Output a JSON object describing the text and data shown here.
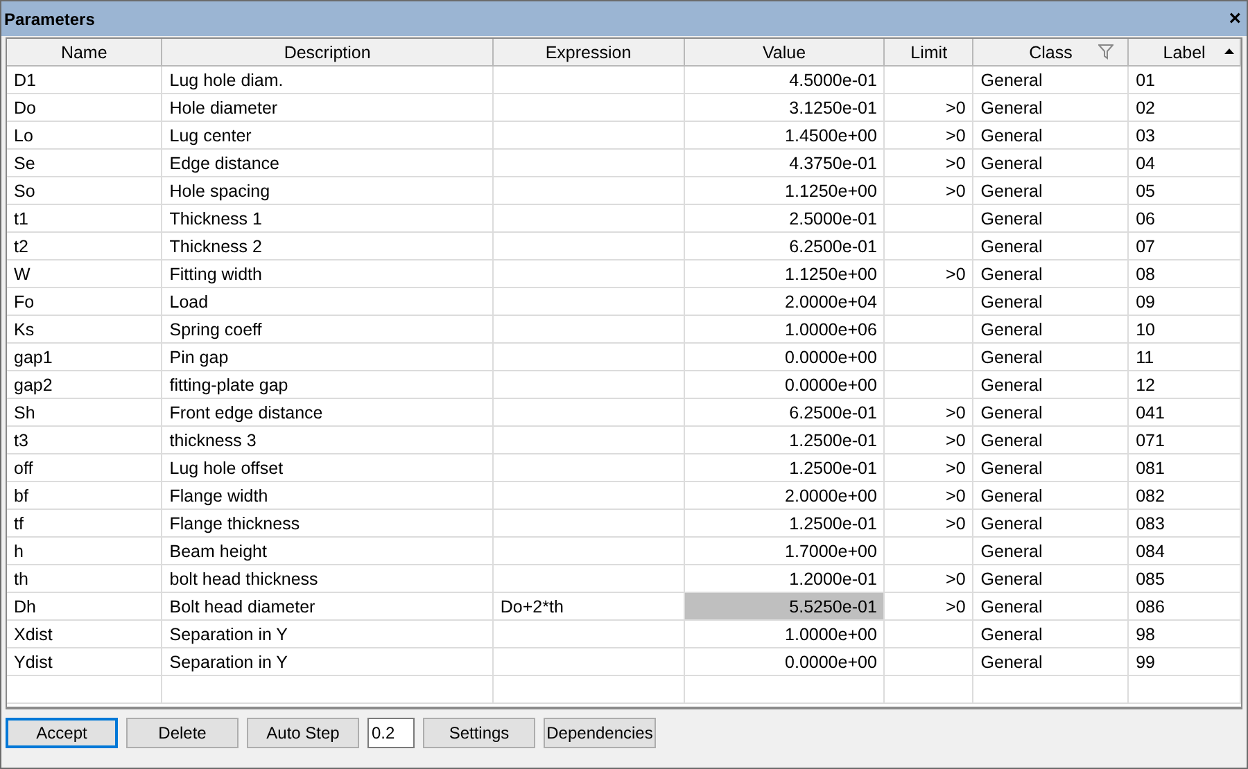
{
  "window": {
    "title": "Parameters",
    "close": "×"
  },
  "table": {
    "columns": [
      {
        "label": "Name",
        "sorted_ascending": false,
        "filter": false
      },
      {
        "label": "Description",
        "sorted_ascending": false,
        "filter": false
      },
      {
        "label": "Expression",
        "sorted_ascending": false,
        "filter": false
      },
      {
        "label": "Value",
        "sorted_ascending": false,
        "filter": false
      },
      {
        "label": "Limit",
        "sorted_ascending": false,
        "filter": false
      },
      {
        "label": "Class",
        "sorted_ascending": false,
        "filter": true
      },
      {
        "label": "Label",
        "sorted_ascending": true,
        "filter": false
      }
    ],
    "rows": [
      {
        "cells": [
          "D1",
          "Lug hole diam.",
          "",
          "4.5000e-01",
          "",
          "General",
          "01"
        ],
        "selected": false
      },
      {
        "cells": [
          "Do",
          "Hole diameter",
          "",
          "3.1250e-01",
          ">0",
          "General",
          "02"
        ],
        "selected": false
      },
      {
        "cells": [
          "Lo",
          "Lug center",
          "",
          "1.4500e+00",
          ">0",
          "General",
          "03"
        ],
        "selected": false
      },
      {
        "cells": [
          "Se",
          "Edge distance",
          "",
          "4.3750e-01",
          ">0",
          "General",
          "04"
        ],
        "selected": false
      },
      {
        "cells": [
          "So",
          "Hole spacing",
          "",
          "1.1250e+00",
          ">0",
          "General",
          "05"
        ],
        "selected": false
      },
      {
        "cells": [
          "t1",
          "Thickness 1",
          "",
          "2.5000e-01",
          "",
          "General",
          "06"
        ],
        "selected": false
      },
      {
        "cells": [
          "t2",
          "Thickness 2",
          "",
          "6.2500e-01",
          "",
          "General",
          "07"
        ],
        "selected": false
      },
      {
        "cells": [
          "W",
          "Fitting width",
          "",
          "1.1250e+00",
          ">0",
          "General",
          "08"
        ],
        "selected": false
      },
      {
        "cells": [
          "Fo",
          "Load",
          "",
          "2.0000e+04",
          "",
          "General",
          "09"
        ],
        "selected": false
      },
      {
        "cells": [
          "Ks",
          "Spring coeff",
          "",
          "1.0000e+06",
          "",
          "General",
          "10"
        ],
        "selected": false
      },
      {
        "cells": [
          "gap1",
          "Pin gap",
          "",
          "0.0000e+00",
          "",
          "General",
          "11"
        ],
        "selected": false
      },
      {
        "cells": [
          "gap2",
          "fitting-plate gap",
          "",
          "0.0000e+00",
          "",
          "General",
          "12"
        ],
        "selected": false
      },
      {
        "cells": [
          "Sh",
          "Front edge distance",
          "",
          "6.2500e-01",
          ">0",
          "General",
          "041"
        ],
        "selected": false
      },
      {
        "cells": [
          "t3",
          "thickness 3",
          "",
          "1.2500e-01",
          ">0",
          "General",
          "071"
        ],
        "selected": false
      },
      {
        "cells": [
          "off",
          "Lug hole offset",
          "",
          "1.2500e-01",
          ">0",
          "General",
          "081"
        ],
        "selected": false
      },
      {
        "cells": [
          "bf",
          "Flange width",
          "",
          "2.0000e+00",
          ">0",
          "General",
          "082"
        ],
        "selected": false
      },
      {
        "cells": [
          "tf",
          "Flange thickness",
          "",
          "1.2500e-01",
          ">0",
          "General",
          "083"
        ],
        "selected": false
      },
      {
        "cells": [
          "h",
          "Beam height",
          "",
          "1.7000e+00",
          "",
          "General",
          "084"
        ],
        "selected": false
      },
      {
        "cells": [
          "th",
          "bolt head thickness",
          "",
          "1.2000e-01",
          ">0",
          "General",
          "085"
        ],
        "selected": false
      },
      {
        "cells": [
          "Dh",
          "Bolt head diameter",
          "Do+2*th",
          "5.5250e-01",
          ">0",
          "General",
          "086"
        ],
        "selected": true
      },
      {
        "cells": [
          "Xdist",
          "Separation in Y",
          "",
          "1.0000e+00",
          "",
          "General",
          "98"
        ],
        "selected": false
      },
      {
        "cells": [
          "Ydist",
          "Separation in Y",
          "",
          "0.0000e+00",
          "",
          "General",
          "99"
        ],
        "selected": false
      }
    ]
  },
  "toolbar": [
    {
      "kind": "button",
      "label": "Accept",
      "focused": true
    },
    {
      "kind": "button",
      "label": "Delete",
      "focused": false
    },
    {
      "kind": "button",
      "label": "Auto Step",
      "focused": false
    },
    {
      "kind": "field",
      "value": "0.2"
    },
    {
      "kind": "button",
      "label": "Settings",
      "focused": false
    },
    {
      "kind": "button",
      "label": "Dependencies",
      "focused": false
    }
  ]
}
